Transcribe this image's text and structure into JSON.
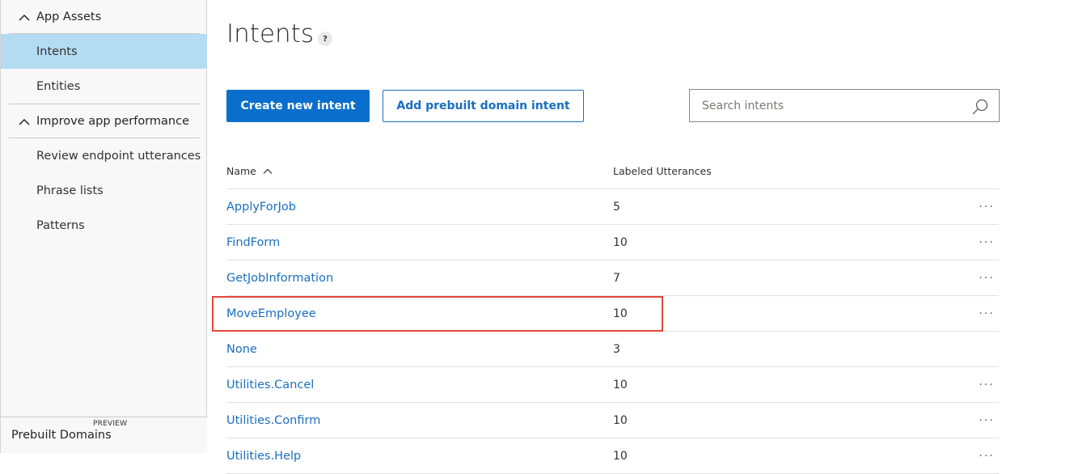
{
  "sidebar": {
    "sections": [
      {
        "label": "App Assets"
      },
      {
        "label": "Improve app performance"
      }
    ],
    "items": [
      {
        "label": "Intents",
        "active": true
      },
      {
        "label": "Entities",
        "active": false
      },
      {
        "label": "Review endpoint utterances",
        "active": false
      },
      {
        "label": "Phrase lists",
        "active": false
      },
      {
        "label": "Patterns",
        "active": false
      }
    ],
    "footer": {
      "title": "Prebuilt Domains",
      "badge": "PREVIEW"
    }
  },
  "main": {
    "title": "Intents",
    "help_label": "?",
    "create_button": "Create new intent",
    "prebuilt_button": "Add prebuilt domain intent",
    "search": {
      "placeholder": "Search intents",
      "value": ""
    },
    "columns": {
      "name": "Name",
      "count": "Labeled Utterances"
    },
    "more_label": "···",
    "rows": [
      {
        "name": "ApplyForJob",
        "count": "5"
      },
      {
        "name": "FindForm",
        "count": "10"
      },
      {
        "name": "GetJobInformation",
        "count": "7"
      },
      {
        "name": "MoveEmployee",
        "count": "10",
        "highlighted": true
      },
      {
        "name": "None",
        "count": "3"
      },
      {
        "name": "Utilities.Cancel",
        "count": "10"
      },
      {
        "name": "Utilities.Confirm",
        "count": "10"
      },
      {
        "name": "Utilities.Help",
        "count": "10"
      }
    ]
  },
  "colors": {
    "accent": "#0a6fcc",
    "link": "#1a6fbf",
    "active_item": "#b3dbf2",
    "highlight_border": "#e0483a"
  }
}
